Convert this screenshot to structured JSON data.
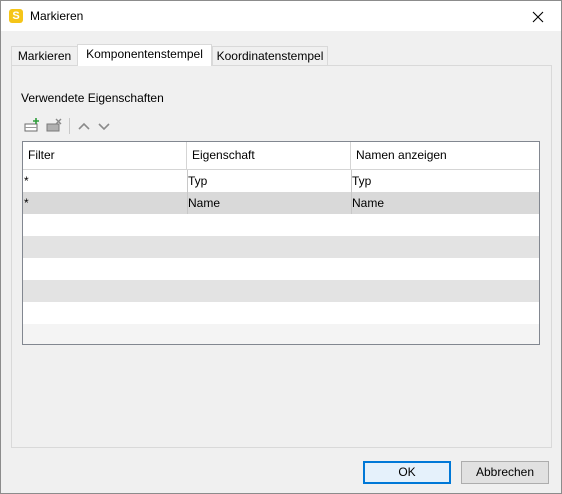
{
  "window": {
    "title": "Markieren",
    "icon_letter": "S"
  },
  "tabs": [
    {
      "label": "Markieren",
      "active": false
    },
    {
      "label": "Komponentenstempel",
      "active": true
    },
    {
      "label": "Koordinatenstempel",
      "active": false
    }
  ],
  "section": {
    "label": "Verwendete Eigenschaften"
  },
  "toolbar": {
    "add_icon": "add-row-icon",
    "remove_icon": "remove-row-icon",
    "up_icon": "chevron-up-icon",
    "down_icon": "chevron-down-icon"
  },
  "table": {
    "columns": [
      "Filter",
      "Eigenschaft",
      "Namen anzeigen"
    ],
    "rows": [
      {
        "filter": "*",
        "eigenschaft": "Typ",
        "namen": "Typ"
      },
      {
        "filter": "*",
        "eigenschaft": "Name",
        "namen": "Name"
      }
    ]
  },
  "buttons": {
    "ok": "OK",
    "cancel": "Abbrechen"
  }
}
